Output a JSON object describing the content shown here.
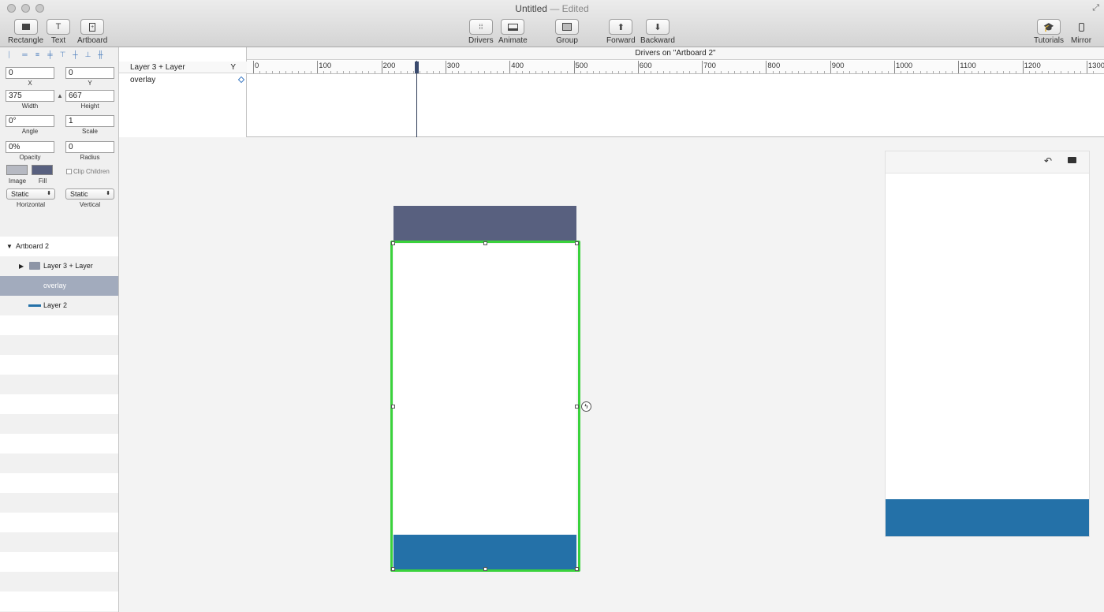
{
  "window": {
    "title": "Untitled",
    "edited": "— Edited"
  },
  "toolbar": {
    "rectangle": "Rectangle",
    "text": "Text",
    "artboard": "Artboard",
    "drivers": "Drivers",
    "animate": "Animate",
    "group": "Group",
    "forward": "Forward",
    "backward": "Backward",
    "tutorials": "Tutorials",
    "mirror": "Mirror"
  },
  "inspector": {
    "x_value": "0",
    "x_label": "X",
    "y_value": "0",
    "y_label": "Y",
    "width_value": "375",
    "width_label": "Width",
    "height_value": "667",
    "height_label": "Height",
    "angle_value": "0°",
    "angle_label": "Angle",
    "scale_value": "1",
    "scale_label": "Scale",
    "opacity_value": "0%",
    "opacity_label": "Opacity",
    "radius_value": "0",
    "radius_label": "Radius",
    "image_label": "Image",
    "fill_label": "Fill",
    "clip_children": "Clip Children",
    "horizontal_value": "Static",
    "horizontal_label": "Horizontal",
    "vertical_value": "Static",
    "vertical_label": "Vertical",
    "image_color": "#b6b9c2",
    "fill_color": "#58607f"
  },
  "layers": {
    "artboard": "Artboard 2",
    "group": "Layer 3 + Layer",
    "overlay": "overlay",
    "layer2": "Layer 2"
  },
  "drivers": {
    "title": "Drivers on \"Artboard 2\"",
    "column_layer": "Layer 3 + Layer",
    "column_axis": "Y",
    "row_property": "overlay",
    "ruler": [
      "0",
      "100",
      "200",
      "300",
      "400",
      "500",
      "600",
      "700",
      "800",
      "900",
      "1000",
      "1100",
      "1200",
      "1300"
    ]
  },
  "colors": {
    "selection": "#3ad23c",
    "accent_blue": "#2471a8",
    "slate": "#58607f"
  }
}
